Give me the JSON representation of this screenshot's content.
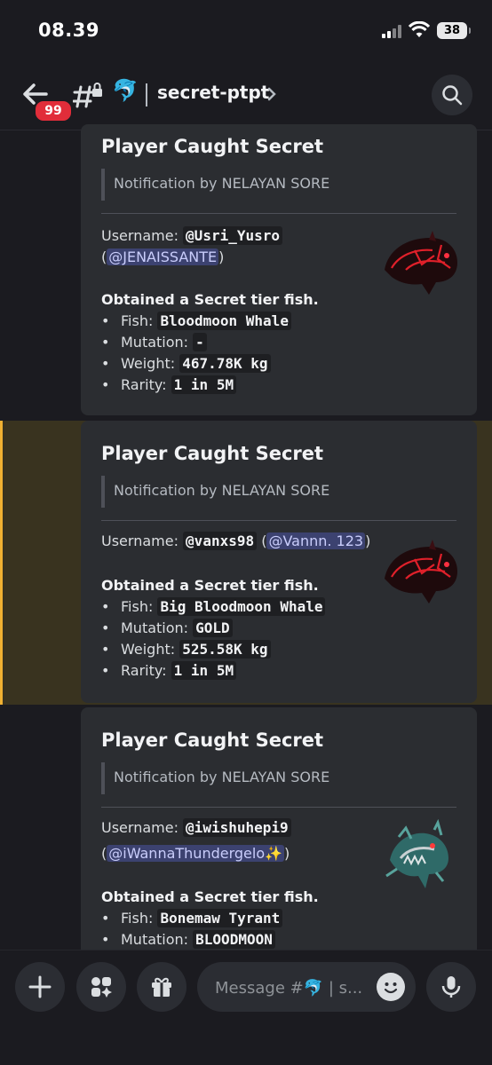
{
  "status": {
    "time": "08.39",
    "battery": "38"
  },
  "header": {
    "badge": "99",
    "channel_emoji": "🐬",
    "channel_name": "secret-ptpt"
  },
  "messages": [
    {
      "title": "Player Caught Secret",
      "note": "Notification by NELAYAN SORE",
      "username_label": "Username:",
      "username": "@Usri_Yusro",
      "mention": "@JENAISSANTE",
      "obtained": "Obtained a Secret tier fish.",
      "fish_label": "Fish:",
      "fish": "Bloodmoon Whale",
      "mutation_label": "Mutation:",
      "mutation": "-",
      "weight_label": "Weight:",
      "weight": "467.78K kg",
      "rarity_label": "Rarity:",
      "rarity": "1 in 5M",
      "thumb_icon": "bloodmoon-whale-icon"
    },
    {
      "title": "Player Caught Secret",
      "note": "Notification by NELAYAN SORE",
      "username_label": "Username:",
      "username": "@vanxs98",
      "mention": "@Vannn. 123",
      "obtained": "Obtained a Secret tier fish.",
      "fish_label": "Fish:",
      "fish": "Big Bloodmoon Whale",
      "mutation_label": "Mutation:",
      "mutation": "GOLD",
      "weight_label": "Weight:",
      "weight": "525.58K kg",
      "rarity_label": "Rarity:",
      "rarity": "1 in 5M",
      "thumb_icon": "bloodmoon-whale-icon"
    },
    {
      "title": "Player Caught Secret",
      "note": "Notification by NELAYAN SORE",
      "username_label": "Username:",
      "username": "@iwishuhepi9",
      "mention": "@iWannaThundergelo✨",
      "obtained": "Obtained a Secret tier fish.",
      "fish_label": "Fish:",
      "fish": "Bonemaw Tyrant",
      "mutation_label": "Mutation:",
      "mutation": "BLOODMOON",
      "thumb_icon": "bonemaw-tyrant-icon"
    }
  ],
  "composer": {
    "placeholder": "Message #🐬 | s..."
  },
  "colors": {
    "accent_highlight": "#f0b132",
    "badge": "#e12d3a",
    "mention_bg": "#3c4270"
  }
}
